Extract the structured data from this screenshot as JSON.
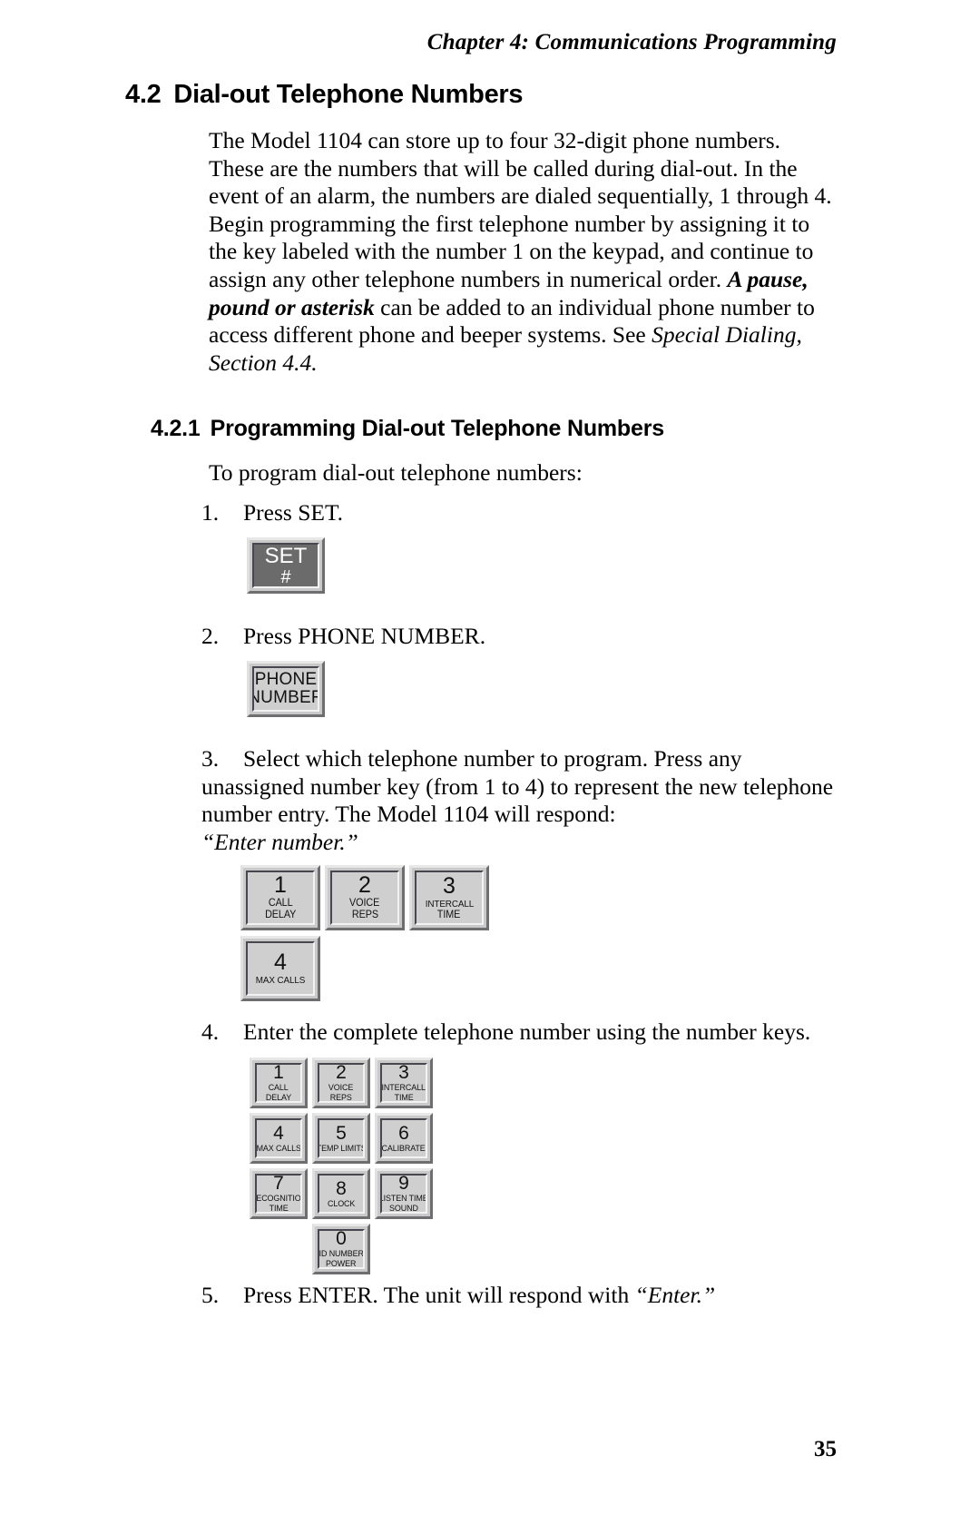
{
  "header": {
    "running_head": "Chapter 4:  Communications Programming"
  },
  "sections": {
    "s42": {
      "number": "4.2",
      "title": "Dial-out Telephone Numbers",
      "paragraph_part1": "The Model 1104 can store up to four 32-digit phone numbers. These are the numbers that will be called during dial-out. In the event of an alarm, the numbers are dialed sequentially, 1 through 4. Begin programming the first telephone number by assigning it to the key labeled with the number 1 on the keypad, and continue to assign any other telephone numbers in numerical order.",
      "paragraph_emph": "A pause, pound or asterisk",
      "paragraph_part2": " can be added to an individual phone number to access different phone and beeper systems. See ",
      "paragraph_ref": "Special Dialing, Section 4.4."
    },
    "s421": {
      "number": "4.2.1",
      "title": "Programming Dial-out Telephone Numbers",
      "lead": "To program dial-out telephone numbers:"
    }
  },
  "steps": [
    {
      "marker": "1.",
      "text": "Press SET."
    },
    {
      "marker": "2.",
      "text": "Press PHONE NUMBER."
    },
    {
      "marker": "3.",
      "text": "Select which telephone number to program. Press any unassigned number key (from 1 to 4) to represent the new telephone number entry. The Model 1104 will respond:",
      "quote": "“Enter number.”"
    },
    {
      "marker": "4.",
      "text": "Enter the complete telephone number using the number keys."
    },
    {
      "marker": "5.",
      "text_before": "Press ENTER. The unit will respond with ",
      "quote": "“Enter.”"
    }
  ],
  "keys": {
    "set": {
      "digit": "SET",
      "sub": "#"
    },
    "phone": {
      "line1": "PHONE",
      "line2": "NUMBER"
    },
    "keypad_step3": [
      {
        "digit": "1",
        "label1": "CALL",
        "label2": "DELAY"
      },
      {
        "digit": "2",
        "label1": "VOICE",
        "label2": "REPS"
      },
      {
        "digit": "3",
        "label1": "INTERCALL",
        "label2": "TIME"
      },
      {
        "digit": "4",
        "label1": "MAX CALLS",
        "label2": ""
      }
    ],
    "keypad_step4": [
      {
        "digit": "1",
        "label1": "CALL",
        "label2": "DELAY"
      },
      {
        "digit": "2",
        "label1": "VOICE",
        "label2": "REPS"
      },
      {
        "digit": "3",
        "label1": "INTERCALL",
        "label2": "TIME"
      },
      {
        "digit": "4",
        "label1": "MAX CALLS",
        "label2": ""
      },
      {
        "digit": "5",
        "label1": "TEMP LIMITS",
        "label2": ""
      },
      {
        "digit": "6",
        "label1": "CALIBRATE",
        "label2": ""
      },
      {
        "digit": "7",
        "label1": "RECOGNITION",
        "label2": "TIME"
      },
      {
        "digit": "8",
        "label1": "CLOCK",
        "label2": ""
      },
      {
        "digit": "9",
        "label1": "LISTEN TIME",
        "label2": "SOUND"
      },
      {
        "digit": "0",
        "label1": "ID NUMBER",
        "label2": "POWER"
      }
    ]
  },
  "footer": {
    "page_number": "35"
  }
}
